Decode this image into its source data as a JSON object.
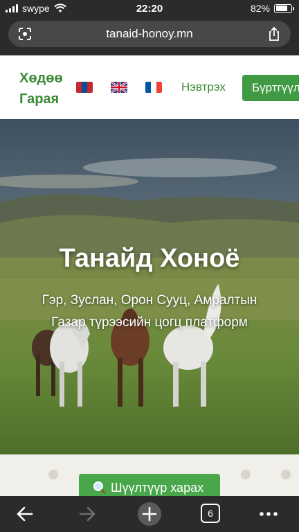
{
  "status_bar": {
    "carrier": "swype",
    "time": "22:20",
    "battery_text": "82%",
    "battery_level": 0.82
  },
  "browser": {
    "url": "tanaid-honoy.mn",
    "tabs_count": "6",
    "icons": [
      "lens-icon",
      "share-icon",
      "back-icon",
      "forward-icon",
      "new-tab-icon",
      "tabs-icon",
      "more-icon"
    ]
  },
  "site": {
    "brand_line1": "Хөдөө",
    "brand_line2": "Гарая",
    "flags": [
      "mongolia-flag-icon",
      "uk-flag-icon",
      "france-flag-icon"
    ],
    "login_label": "Нэвтрэх",
    "register_label": "Бүртгүүлэх",
    "accent_color": "#3d8b37"
  },
  "hero": {
    "title": "Танайд Хоноё",
    "subtitle_line1": "Гэр, Зуслан, Орон Сууц, Амралтын",
    "subtitle_line2": "Газар түрээсийн цогц платформ"
  },
  "filter": {
    "label": "Шүүлтүүр харах"
  }
}
